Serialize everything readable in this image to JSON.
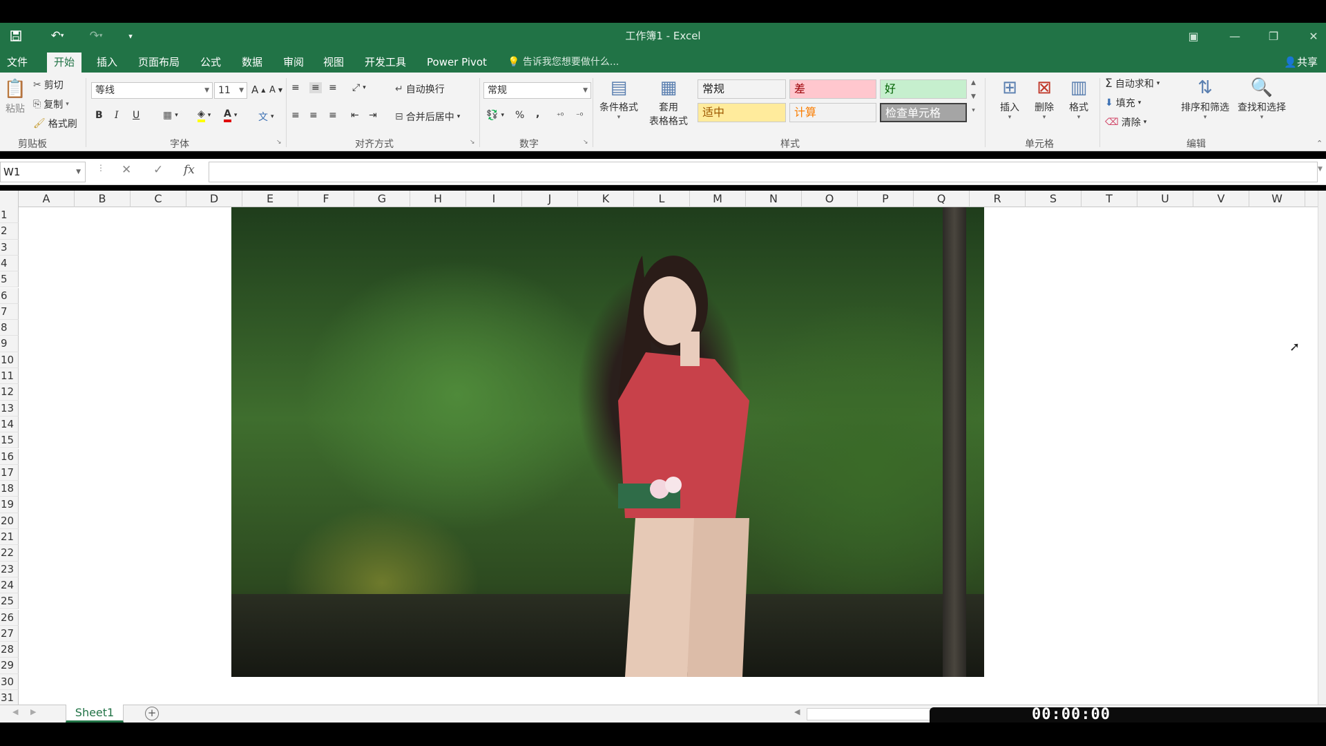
{
  "window": {
    "title": "工作簿1 - Excel"
  },
  "tabs": [
    "文件",
    "开始",
    "插入",
    "页面布局",
    "公式",
    "数据",
    "审阅",
    "视图",
    "开发工具",
    "Power Pivot"
  ],
  "active_tab": "开始",
  "tell_me": "告诉我您想要做什么...",
  "share": "共享",
  "clipboard": {
    "paste": "粘贴",
    "cut": "剪切",
    "copy": "复制",
    "format_painter": "格式刷",
    "label": "剪贴板"
  },
  "font": {
    "name": "等线",
    "size": "11",
    "label": "字体",
    "bold": "B",
    "italic": "I",
    "underline": "U"
  },
  "alignment": {
    "wrap": "自动换行",
    "merge": "合并后居中",
    "label": "对齐方式"
  },
  "number": {
    "format": "常规",
    "percent": "%",
    "comma": ",",
    "label": "数字"
  },
  "styles": {
    "conditional": "条件格式",
    "table_format_1": "套用",
    "table_format_2": "表格格式",
    "label": "样式",
    "cells": [
      {
        "text": "常规",
        "bg": "#ffffff",
        "color": "#000000"
      },
      {
        "text": "差",
        "bg": "#ffc7ce",
        "color": "#9c0006"
      },
      {
        "text": "好",
        "bg": "#c6efce",
        "color": "#006100"
      },
      {
        "text": "适中",
        "bg": "#ffeb9c",
        "color": "#9c5700"
      },
      {
        "text": "计算",
        "bg": "#f2f2f2",
        "color": "#fa7d00"
      },
      {
        "text": "检查单元格",
        "bg": "#a5a5a5",
        "color": "#ffffff"
      }
    ]
  },
  "cells_group": {
    "insert": "插入",
    "delete": "删除",
    "format": "格式",
    "label": "单元格"
  },
  "editing": {
    "autosum": "自动求和",
    "fill": "填充",
    "clear": "清除",
    "sort": "排序和筛选",
    "find": "查找和选择",
    "label": "编辑"
  },
  "formula_bar": {
    "name_box": "W1",
    "fx": "fx",
    "value": ""
  },
  "columns": [
    "A",
    "B",
    "C",
    "D",
    "E",
    "F",
    "G",
    "H",
    "I",
    "J",
    "K",
    "L",
    "M",
    "N",
    "O",
    "P",
    "Q",
    "R",
    "S",
    "T",
    "U",
    "V",
    "W"
  ],
  "rows": [
    "1",
    "2",
    "3",
    "4",
    "5",
    "6",
    "7",
    "8",
    "9",
    "10",
    "11",
    "12",
    "13",
    "14",
    "15",
    "16",
    "17",
    "18",
    "19",
    "20",
    "21",
    "22",
    "23",
    "24",
    "25",
    "26",
    "27",
    "28",
    "29",
    "30",
    "31"
  ],
  "sheets": [
    "Sheet1"
  ],
  "recorder_time": "00:00:00",
  "colors": {
    "excel_green": "#217346",
    "ribbon_bg": "#f3f3f3"
  }
}
